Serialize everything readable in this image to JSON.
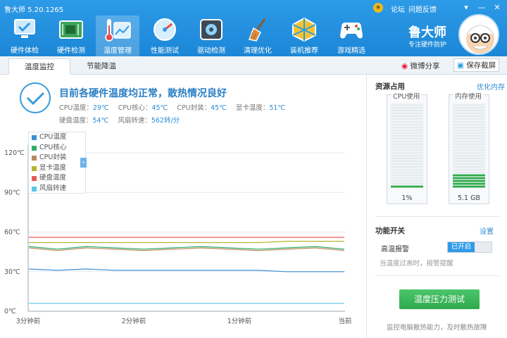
{
  "window": {
    "title": "鲁大师 5.20.1265",
    "links": [
      "论坛",
      "问题反馈"
    ],
    "controls": [
      "▾",
      "—",
      "✕"
    ]
  },
  "toolbar": {
    "items": [
      {
        "label": "硬件体检",
        "icon": "pc-check-icon"
      },
      {
        "label": "硬件检测",
        "icon": "circuit-board-icon"
      },
      {
        "label": "温度管理",
        "icon": "thermometer-chart-icon",
        "active": true
      },
      {
        "label": "性能测试",
        "icon": "speedometer-icon"
      },
      {
        "label": "驱动检测",
        "icon": "gear-box-icon"
      },
      {
        "label": "清理优化",
        "icon": "broom-icon"
      },
      {
        "label": "装机推荐",
        "icon": "cube-icon"
      },
      {
        "label": "游戏精选",
        "icon": "gamepad-icon"
      }
    ],
    "brand": "鲁大师",
    "brand_sub": "专注硬件防护"
  },
  "tabs": [
    "温度监控",
    "节能降温"
  ],
  "share": {
    "weibo": "微博分享",
    "screenshot": "保存截屏"
  },
  "status": {
    "headline": "目前各硬件温度均正常，散热情况良好",
    "row1": [
      {
        "label": "CPU温度：",
        "value": "29℃"
      },
      {
        "label": "CPU核心：",
        "value": "45℃"
      },
      {
        "label": "CPU封装：",
        "value": "45℃"
      },
      {
        "label": "显卡温度：",
        "value": "51℃"
      }
    ],
    "row2": [
      {
        "label": "硬盘温度：",
        "value": "54℃"
      },
      {
        "label": "风扇转速：",
        "value": "562转/分"
      }
    ]
  },
  "chart_data": {
    "type": "line",
    "y_ticks": [
      "120℃",
      "90℃",
      "60℃",
      "30℃",
      "0℃"
    ],
    "ylim": [
      0,
      120
    ],
    "x_ticks": [
      "3分钟前",
      "2分钟前",
      "1分钟前",
      "当前"
    ],
    "legend": [
      {
        "name": "CPU温度",
        "color": "#3b8fd6"
      },
      {
        "name": "CPU核心",
        "color": "#2fae6b"
      },
      {
        "name": "CPU封装",
        "color": "#b98a5e"
      },
      {
        "name": "显卡温度",
        "color": "#b5b531"
      },
      {
        "name": "硬盘温度",
        "color": "#e65a5a"
      },
      {
        "name": "风扇转速",
        "color": "#5ac8e6"
      }
    ],
    "series": [
      {
        "name": "硬盘温度",
        "values": [
          56,
          56,
          56,
          56,
          56,
          56,
          56,
          56,
          56,
          56,
          56,
          56
        ]
      },
      {
        "name": "显卡温度",
        "values": [
          52,
          52,
          52,
          52,
          52,
          52,
          52,
          52,
          52,
          53,
          53,
          53
        ]
      },
      {
        "name": "CPU核心",
        "values": [
          49,
          47,
          49,
          48,
          47,
          48,
          49,
          48,
          47,
          48,
          49,
          47
        ]
      },
      {
        "name": "CPU封装",
        "values": [
          48,
          46,
          48,
          47,
          46,
          47,
          48,
          47,
          46,
          47,
          48,
          46
        ]
      },
      {
        "name": "CPU温度",
        "values": [
          32,
          31,
          32,
          31,
          31,
          31,
          31,
          31,
          31,
          30,
          30,
          30
        ]
      },
      {
        "name": "风扇转速",
        "values": [
          6,
          6,
          6,
          6,
          6,
          6,
          6,
          6,
          6,
          6,
          6,
          6
        ]
      }
    ]
  },
  "resources": {
    "title": "资源占用",
    "link": "优化内存",
    "cpu": {
      "label": "CPU使用",
      "value": "1%",
      "fraction": 0.01
    },
    "mem": {
      "label": "内存使用",
      "value": "5.1 GB",
      "fraction": 0.16
    }
  },
  "features": {
    "title": "功能开关",
    "link": "设置",
    "alarm_label": "高温报警",
    "alarm_state": "已开启",
    "hint": "当温度过高时，报警提醒",
    "stress_button": "温度压力测试",
    "bottom_hint": "监控电脑散热能力，及时散热故障"
  }
}
